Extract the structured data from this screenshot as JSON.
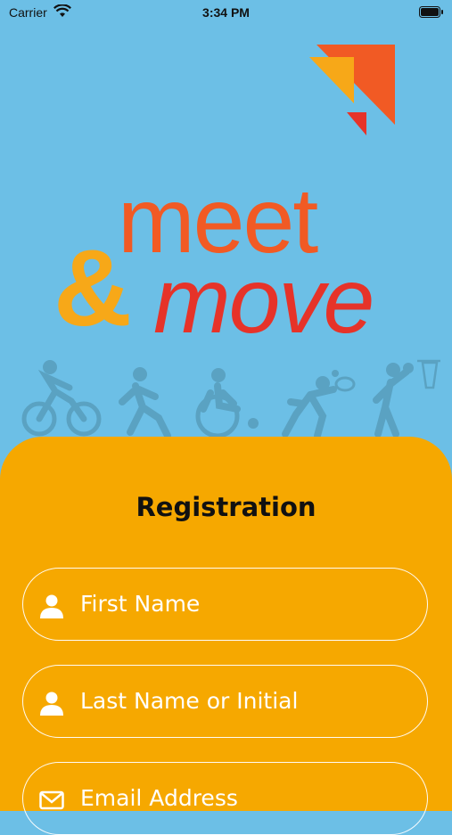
{
  "status_bar": {
    "carrier": "Carrier",
    "time": "3:34 PM"
  },
  "logo": {
    "line1": "meet",
    "ampersand": "&",
    "line2": "move"
  },
  "colors": {
    "background": "#6cbfe6",
    "card": "#f6a800",
    "orange": "#f15a24",
    "red": "#e63329",
    "amber": "#f7a818"
  },
  "registration": {
    "title": "Registration",
    "fields": [
      {
        "icon": "person-icon",
        "placeholder": "First Name"
      },
      {
        "icon": "person-icon",
        "placeholder": "Last Name or Initial"
      },
      {
        "icon": "envelope-icon",
        "placeholder": "Email Address"
      }
    ]
  }
}
